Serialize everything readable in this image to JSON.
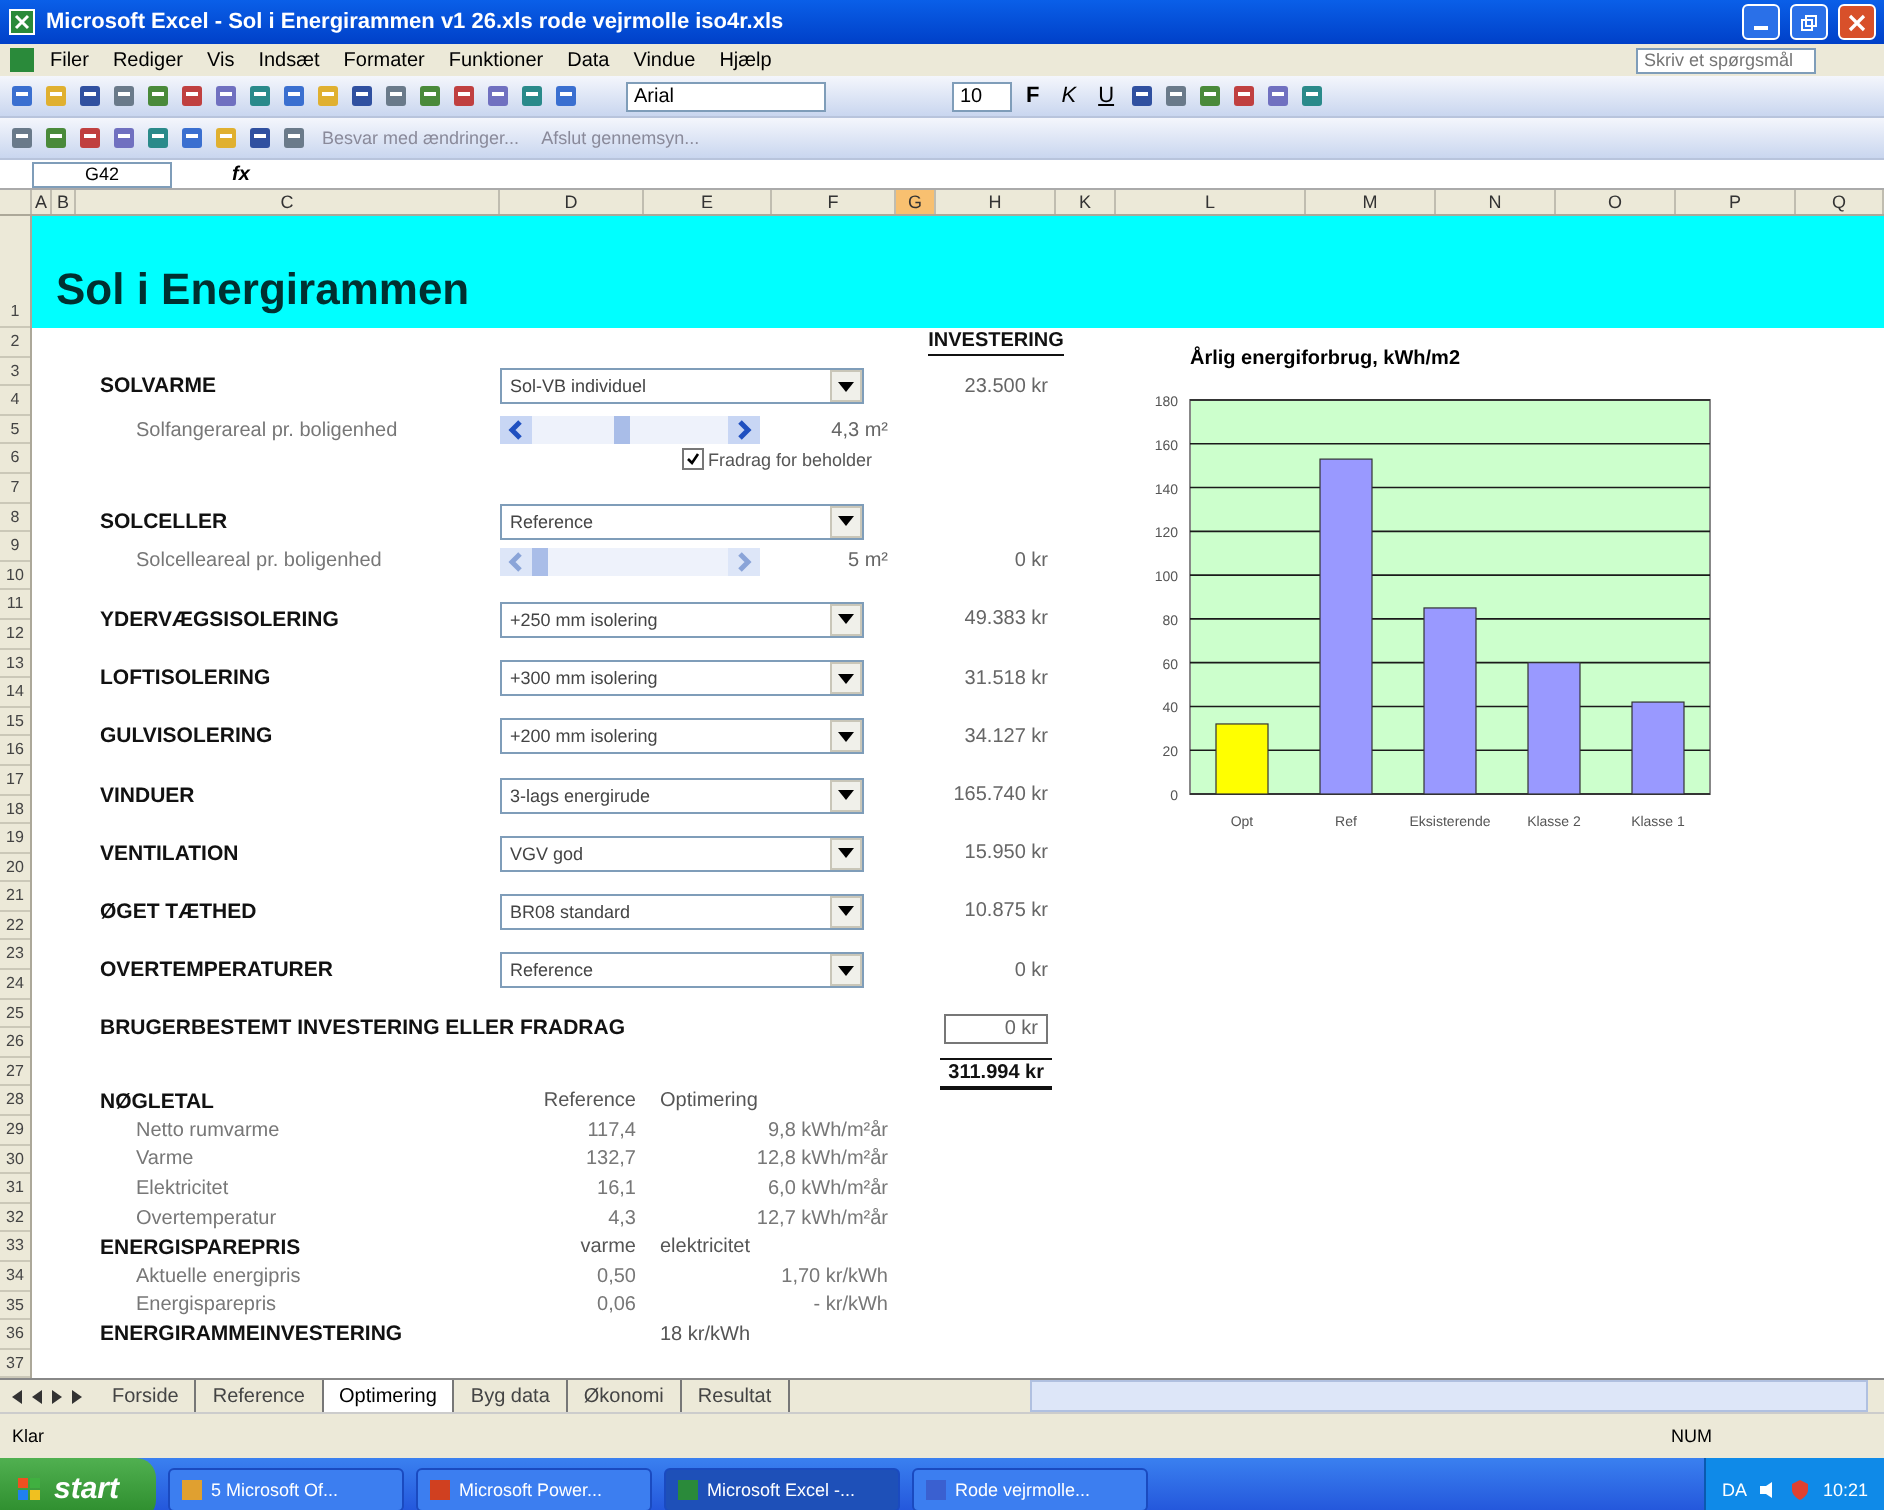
{
  "window": {
    "title": "Microsoft Excel - Sol i Energirammen v1 26.xls rode vejrmolle iso4r.xls"
  },
  "menu": [
    "Filer",
    "Rediger",
    "Vis",
    "Indsæt",
    "Formater",
    "Funktioner",
    "Data",
    "Vindue",
    "Hjælp"
  ],
  "help_box": {
    "placeholder": "Skriv et spørgsmål"
  },
  "toolbar": {
    "font": "Arial",
    "size": "10",
    "format_buttons": [
      "F",
      "K",
      "U"
    ]
  },
  "review_toolbar": [
    "Besvar med ændringer...",
    "Afslut gennemsyn..."
  ],
  "name_box": "G42",
  "formula_label": "fx",
  "columns": [
    {
      "label": "A",
      "selected": false
    },
    {
      "label": "B",
      "selected": false
    },
    {
      "label": "C",
      "selected": false
    },
    {
      "label": "D",
      "selected": false
    },
    {
      "label": "E",
      "selected": false
    },
    {
      "label": "F",
      "selected": false
    },
    {
      "label": "G",
      "selected": true
    },
    {
      "label": "H",
      "selected": false
    },
    {
      "label": "K",
      "selected": false
    },
    {
      "label": "L",
      "selected": false
    },
    {
      "label": "M",
      "selected": false
    },
    {
      "label": "N",
      "selected": false
    },
    {
      "label": "O",
      "selected": false
    },
    {
      "label": "P",
      "selected": false
    },
    {
      "label": "Q",
      "selected": false
    }
  ],
  "sheet_title": {
    "row": "1",
    "text": "Sol i Energirammen"
  },
  "lines": [
    {
      "kind": "heading",
      "rows": [
        "2"
      ],
      "amount": "INVESTERING"
    },
    {
      "kind": "select",
      "rows": [
        "3",
        "4"
      ],
      "label": "SOLVARME",
      "value": "Sol-VB individuel",
      "amount": "23.500 kr"
    },
    {
      "kind": "scroll",
      "rows": [
        "5"
      ],
      "label": "Solfangerareal pr. boligenhed",
      "level": 0.45,
      "disabled": false,
      "reading": "4,3 m²"
    },
    {
      "kind": "checkbox",
      "rows": [
        "6"
      ],
      "label": "Fradrag for beholder",
      "checked": true
    },
    {
      "kind": "blank",
      "rows": [
        "7"
      ]
    },
    {
      "kind": "select",
      "rows": [
        "8"
      ],
      "label": "SOLCELLER",
      "value": "Reference"
    },
    {
      "kind": "scroll",
      "rows": [
        "9",
        "10"
      ],
      "label": "Solcelleareal pr. boligenhed",
      "disabled": true,
      "reading": "5 m²",
      "amount": "0 kr"
    },
    {
      "kind": "select",
      "rows": [
        "11",
        "12"
      ],
      "label": "YDERVÆGSISOLERING",
      "value": "+250 mm isolering",
      "amount": "49.383 kr"
    },
    {
      "kind": "select",
      "rows": [
        "13",
        "14"
      ],
      "label": "LOFTISOLERING",
      "value": "+300 mm isolering",
      "amount": "31.518 kr"
    },
    {
      "kind": "select",
      "rows": [
        "15",
        "16"
      ],
      "label": "GULVISOLERING",
      "value": "+200 mm isolering",
      "amount": "34.127 kr"
    },
    {
      "kind": "select",
      "rows": [
        "17",
        "18"
      ],
      "label": "VINDUER",
      "value": "3-lags energirude",
      "amount": "165.740 kr"
    },
    {
      "kind": "select",
      "rows": [
        "19",
        "20"
      ],
      "label": "VENTILATION",
      "value": "VGV god",
      "amount": "15.950 kr"
    },
    {
      "kind": "select",
      "rows": [
        "21",
        "22"
      ],
      "label": "ØGET TÆTHED",
      "value": "BR08 standard",
      "amount": "10.875 kr"
    },
    {
      "kind": "select",
      "rows": [
        "23",
        "24"
      ],
      "label": "OVERTEMPERATURER",
      "value": "Reference",
      "amount": "0 kr"
    },
    {
      "kind": "input",
      "rows": [
        "25",
        "26"
      ],
      "label": "BRUGERBESTEMT INVESTERING ELLER FRADRAG",
      "amount": "0 kr"
    },
    {
      "kind": "total",
      "rows": [
        "27"
      ],
      "amount": "311.994 kr"
    },
    {
      "kind": "table_header",
      "rows": [
        "28"
      ],
      "label": "NØGLETAL",
      "col1": "Reference",
      "col2": "Optimering"
    },
    {
      "kind": "metric",
      "rows": [
        "29"
      ],
      "label": "Netto rumvarme",
      "col1": "117,4",
      "col2": "9,8 kWh/m²år"
    },
    {
      "kind": "metric",
      "rows": [
        "30"
      ],
      "label": "Varme",
      "col1": "132,7",
      "col2": "12,8 kWh/m²år"
    },
    {
      "kind": "metric",
      "rows": [
        "31"
      ],
      "label": "Elektricitet",
      "col1": "16,1",
      "col2": "6,0 kWh/m²år"
    },
    {
      "kind": "metric",
      "rows": [
        "32"
      ],
      "label": "Overtemperatur",
      "col1": "4,3",
      "col2": "12,7 kWh/m²år"
    },
    {
      "kind": "table_header",
      "rows": [
        "33"
      ],
      "label": "ENERGISPAREPRIS",
      "col1": "varme",
      "col2": "elektricitet"
    },
    {
      "kind": "metric",
      "rows": [
        "34"
      ],
      "label": "Aktuelle energipris",
      "col1": "0,50",
      "col2": "1,70 kr/kWh"
    },
    {
      "kind": "metric",
      "rows": [
        "35"
      ],
      "label": "Energisparepris",
      "col1": "0,06",
      "col2": "- kr/kWh"
    },
    {
      "kind": "table_header",
      "rows": [
        "36"
      ],
      "label": "ENERGIRAMMEINVESTERING",
      "col2": "18 kr/kWh"
    },
    {
      "kind": "blank",
      "rows": [
        "37"
      ]
    }
  ],
  "chart": {
    "chart_data": {
      "type": "bar",
      "title": "Årlig energiforbrug, kWh/m2",
      "categories": [
        "Opt",
        "Ref",
        "Eksisterende",
        "Klasse 2",
        "Klasse 1"
      ],
      "series": [
        {
          "color": "#ffff00",
          "values": [
            32,
            null,
            null,
            null,
            null
          ]
        },
        {
          "color": "#9999ff",
          "values": [
            null,
            153,
            85,
            60,
            42
          ]
        }
      ],
      "ylim": [
        0,
        180
      ],
      "yticks": [
        0,
        20,
        40,
        60,
        80,
        100,
        120,
        140,
        160,
        180
      ],
      "stacked": true,
      "grid": true
    }
  },
  "sheet_tabs": [
    {
      "label": "Forside",
      "selected": false
    },
    {
      "label": "Reference",
      "selected": false
    },
    {
      "label": "Optimering",
      "selected": true
    },
    {
      "label": "Byg data",
      "selected": false
    },
    {
      "label": "Økonomi",
      "selected": false
    },
    {
      "label": "Resultat",
      "selected": false
    }
  ],
  "status_bar": {
    "left": "Klar",
    "right": "NUM"
  },
  "taskbar": {
    "start": "start",
    "tasks": [
      {
        "label": "5 Microsoft Of...",
        "selected": false
      },
      {
        "label": "Microsoft Power...",
        "selected": false
      },
      {
        "label": "Microsoft Excel -...",
        "selected": true
      },
      {
        "label": "Rode vejrmolle...",
        "selected": false
      }
    ],
    "language": "DA",
    "clock": "10:21"
  }
}
